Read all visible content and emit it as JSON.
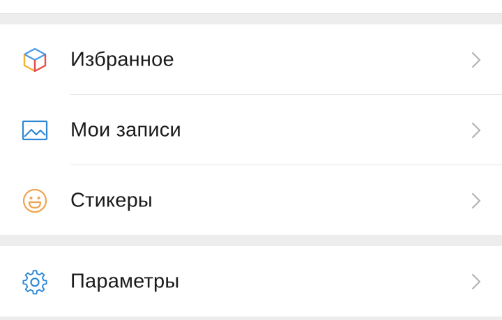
{
  "menu": {
    "groups": [
      {
        "items": [
          {
            "label": "Избранное",
            "icon": "cube-icon",
            "icon_colors": [
              "#f2b233",
              "#e84a4a",
              "#4a9be8"
            ]
          },
          {
            "label": "Мои записи",
            "icon": "image-icon",
            "icon_color": "#2f88d6"
          },
          {
            "label": "Стикеры",
            "icon": "smiley-icon",
            "icon_color": "#f0a450"
          }
        ]
      },
      {
        "items": [
          {
            "label": "Параметры",
            "icon": "gear-icon",
            "icon_color": "#2f88d6"
          }
        ]
      }
    ]
  },
  "colors": {
    "background": "#ededed",
    "card": "#ffffff",
    "text": "#1a1a1a",
    "chevron": "#b3b3b3",
    "divider": "#e6e6e6"
  }
}
